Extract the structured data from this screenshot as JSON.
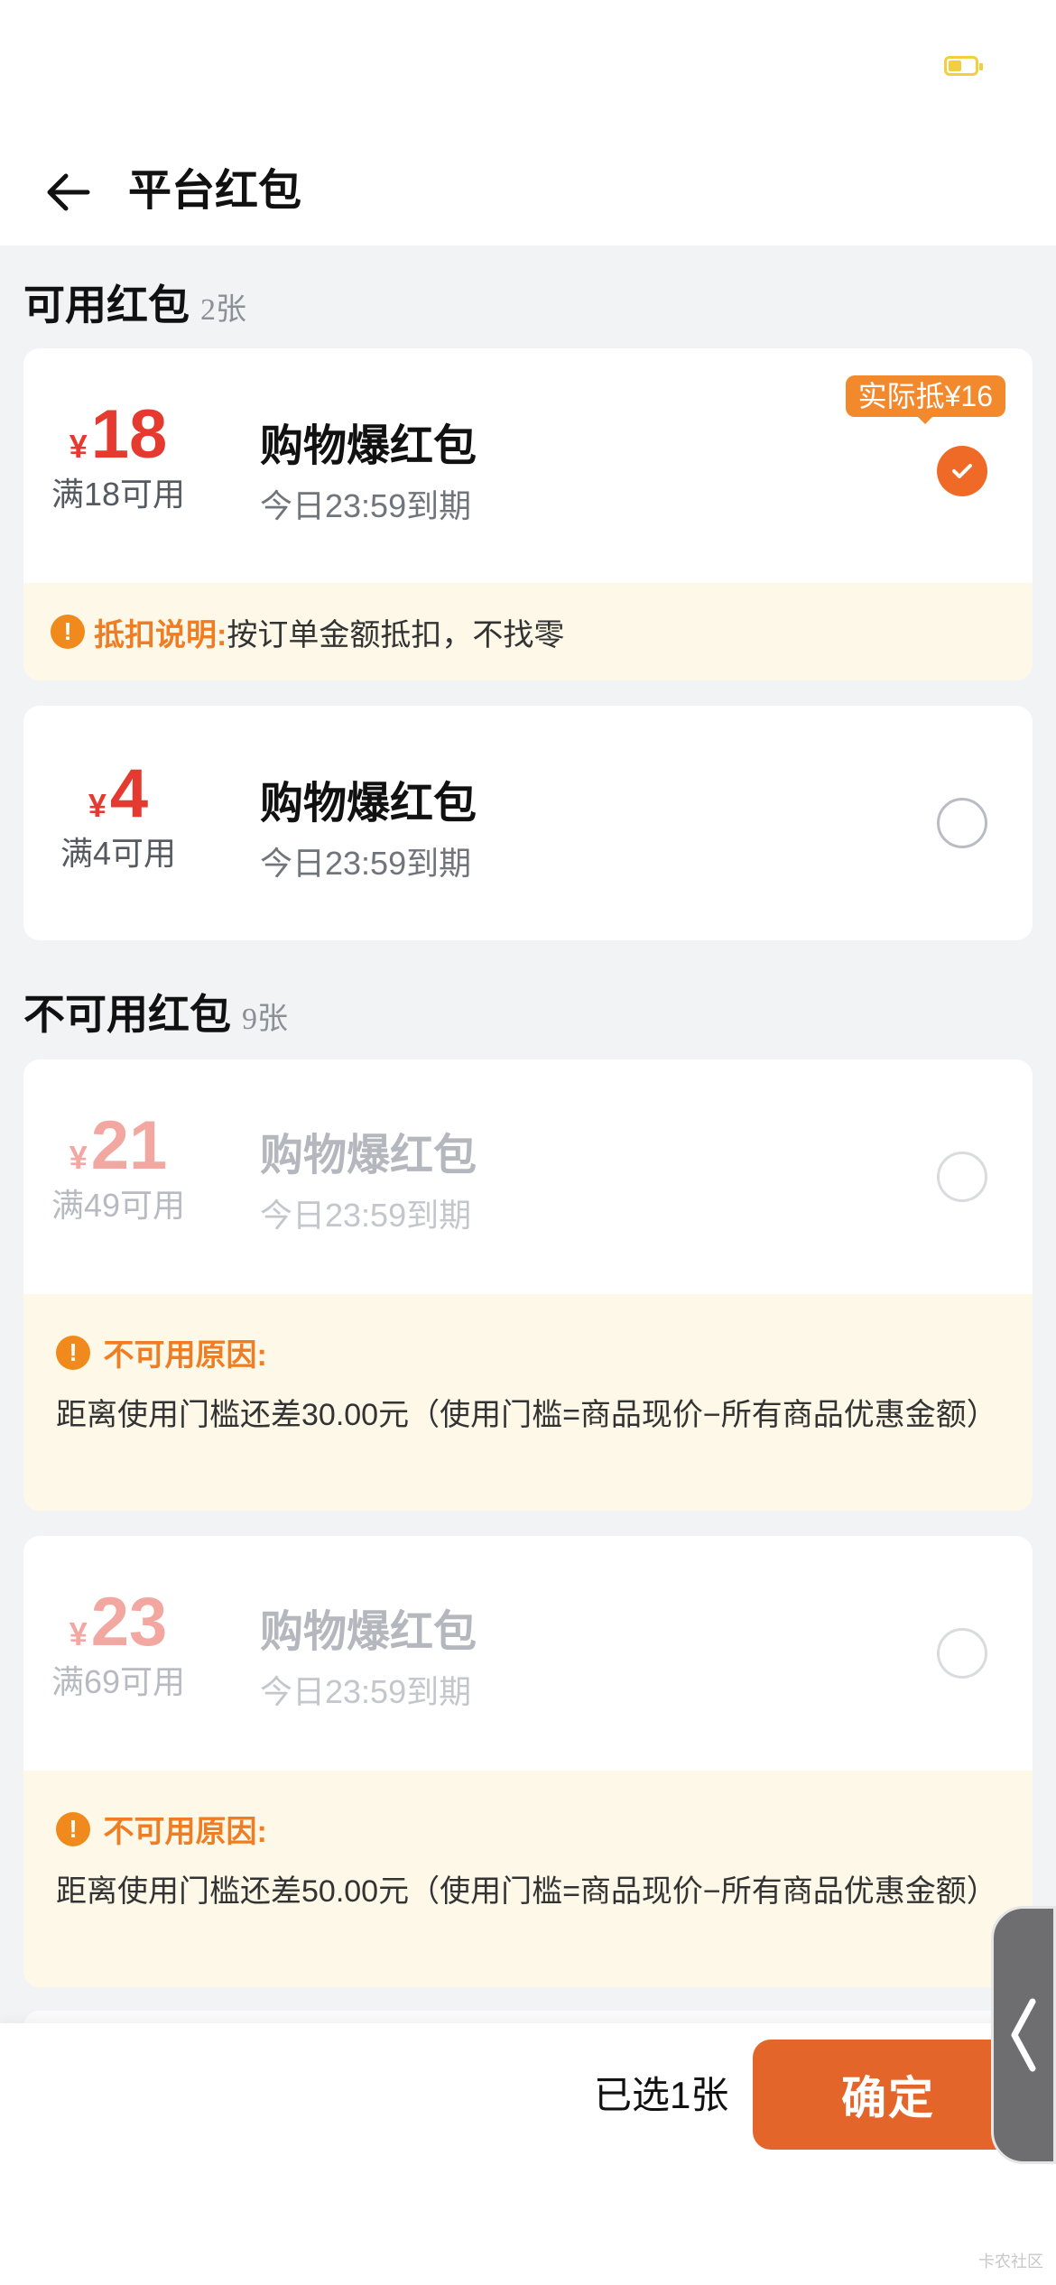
{
  "header": {
    "title": "平台红包"
  },
  "available_section": {
    "title": "可用红包",
    "count": "2张"
  },
  "unavailable_section": {
    "title": "不可用红包",
    "count": "9张"
  },
  "coupons": [
    {
      "yen": "¥",
      "amount": "18",
      "condition": "满18可用",
      "name": "购物爆红包",
      "expire": "今日23:59到期",
      "badge": "实际抵¥16",
      "selected": true,
      "note_label": "抵扣说明:",
      "note_text": "按订单金额抵扣，不找零"
    },
    {
      "yen": "¥",
      "amount": "4",
      "condition": "满4可用",
      "name": "购物爆红包",
      "expire": "今日23:59到期",
      "selected": false
    },
    {
      "yen": "¥",
      "amount": "21",
      "condition": "满49可用",
      "name": "购物爆红包",
      "expire": "今日23:59到期",
      "selected": false,
      "reason_label": "不可用原因:",
      "reason_text": "距离使用门槛还差30.00元（使用门槛=商品现价−所有商品优惠金额）"
    },
    {
      "yen": "¥",
      "amount": "23",
      "condition": "满69可用",
      "name": "购物爆红包",
      "expire": "今日23:59到期",
      "selected": false,
      "reason_label": "不可用原因:",
      "reason_text": "距离使用门槛还差50.00元（使用门槛=商品现价−所有商品优惠金额）"
    }
  ],
  "footer": {
    "selected_text": "已选1张",
    "confirm_label": "确定"
  },
  "watermark": "卡农社区",
  "colors": {
    "accent": "#e4652a",
    "amount_red": "#e43a2f",
    "notice_bg": "#fdf8e8",
    "warn_orange": "#f08a1c"
  }
}
